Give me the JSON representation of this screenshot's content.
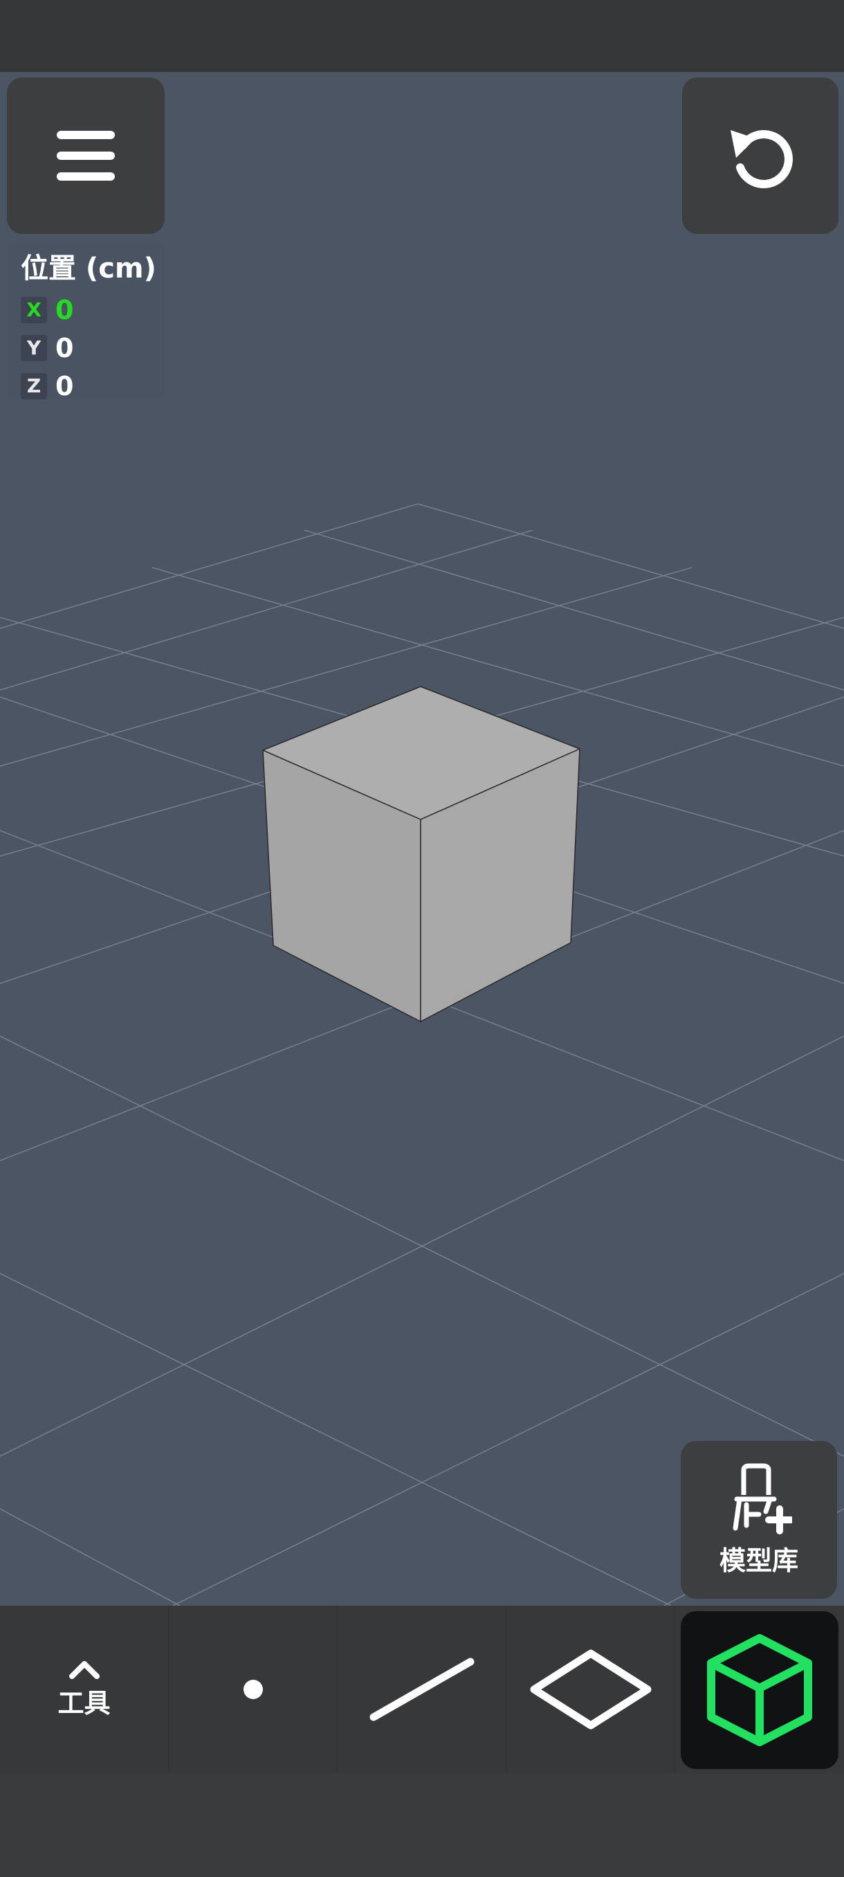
{
  "coords": {
    "title": "位置 (cm)",
    "rows": [
      {
        "axis": "X",
        "value": "0"
      },
      {
        "axis": "Y",
        "value": "0"
      },
      {
        "axis": "Z",
        "value": "0"
      }
    ]
  },
  "model_library": {
    "label": "模型库"
  },
  "toolbar": {
    "tools_label": "工具"
  },
  "colors": {
    "viewport": "#4b5563",
    "accent_green": "#22dd22",
    "panel": "#3d3e40",
    "toolbar": "#37383a",
    "cube_face": "#a9a9a9"
  },
  "icons": {
    "menu": "hamburger-icon",
    "undo": "undo-icon",
    "model_library": "chair-plus-icon",
    "tools_toggle": "chevron-up-icon",
    "point": "point-icon",
    "line": "line-icon",
    "face": "diamond-icon",
    "solid": "cube-icon"
  }
}
